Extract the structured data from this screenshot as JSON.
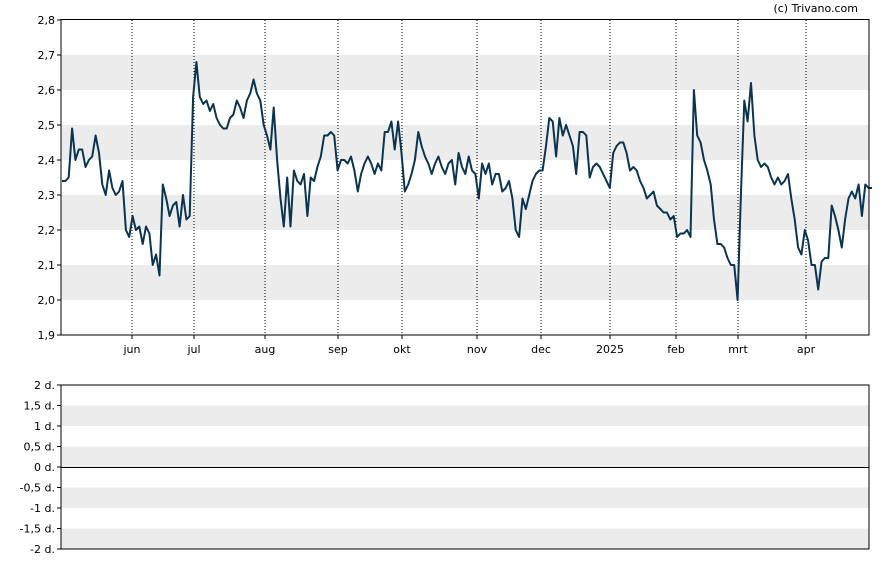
{
  "copyright": "(c) Trivano.com",
  "colors": {
    "line": "#0a3450",
    "band": "#ececec",
    "axis": "#000000"
  },
  "chart_data": [
    {
      "type": "line",
      "x_labels": [
        "jun",
        "jul",
        "aug",
        "sep",
        "okt",
        "nov",
        "dec",
        "2025",
        "feb",
        "mrt",
        "apr"
      ],
      "y_ticks": [
        "1,9",
        "2,0",
        "2,1",
        "2,2",
        "2,3",
        "2,4",
        "2,5",
        "2,6",
        "2,7",
        "2,8"
      ],
      "ylim": [
        1.9,
        2.8
      ],
      "grid": "vertical dotted at month starts, alternating horizontal bands",
      "series": [
        {
          "values": [
            2.34,
            2.34,
            2.35,
            2.49,
            2.4,
            2.43,
            2.43,
            2.38,
            2.4,
            2.41,
            2.47,
            2.42,
            2.33,
            2.3,
            2.37,
            2.32,
            2.3,
            2.31,
            2.34,
            2.2,
            2.18,
            2.24,
            2.2,
            2.21,
            2.16,
            2.21,
            2.19,
            2.1,
            2.13,
            2.07,
            2.33,
            2.29,
            2.24,
            2.27,
            2.28,
            2.21,
            2.3,
            2.23,
            2.24,
            2.58,
            2.68,
            2.58,
            2.56,
            2.57,
            2.54,
            2.56,
            2.52,
            2.5,
            2.49,
            2.49,
            2.52,
            2.53,
            2.57,
            2.55,
            2.52,
            2.57,
            2.59,
            2.63,
            2.59,
            2.57,
            2.5,
            2.47,
            2.43,
            2.55,
            2.4,
            2.29,
            2.21,
            2.35,
            2.21,
            2.37,
            2.34,
            2.33,
            2.36,
            2.24,
            2.35,
            2.34,
            2.38,
            2.41,
            2.47,
            2.47,
            2.48,
            2.47,
            2.37,
            2.4,
            2.4,
            2.39,
            2.41,
            2.37,
            2.31,
            2.36,
            2.39,
            2.41,
            2.39,
            2.36,
            2.39,
            2.37,
            2.48,
            2.48,
            2.51,
            2.43,
            2.51,
            2.42,
            2.31,
            2.33,
            2.36,
            2.4,
            2.48,
            2.44,
            2.41,
            2.39,
            2.36,
            2.39,
            2.41,
            2.38,
            2.36,
            2.39,
            2.4,
            2.33,
            2.42,
            2.38,
            2.36,
            2.41,
            2.37,
            2.36,
            2.29,
            2.39,
            2.36,
            2.39,
            2.33,
            2.36,
            2.36,
            2.31,
            2.32,
            2.34,
            2.29,
            2.2,
            2.18,
            2.29,
            2.26,
            2.3,
            2.34,
            2.36,
            2.37,
            2.37,
            2.44,
            2.52,
            2.51,
            2.41,
            2.52,
            2.47,
            2.5,
            2.47,
            2.44,
            2.36,
            2.48,
            2.48,
            2.47,
            2.35,
            2.38,
            2.39,
            2.38,
            2.36,
            2.34,
            2.32,
            2.42,
            2.44,
            2.45,
            2.45,
            2.42,
            2.37,
            2.38,
            2.37,
            2.34,
            2.32,
            2.29,
            2.3,
            2.31,
            2.27,
            2.26,
            2.25,
            2.25,
            2.23,
            2.24,
            2.18,
            2.19,
            2.19,
            2.2,
            2.18,
            2.6,
            2.47,
            2.45,
            2.4,
            2.37,
            2.33,
            2.23,
            2.16,
            2.16,
            2.15,
            2.12,
            2.1,
            2.1,
            2.0,
            2.3,
            2.57,
            2.51,
            2.62,
            2.47,
            2.4,
            2.38,
            2.39,
            2.38,
            2.35,
            2.33,
            2.35,
            2.33,
            2.34,
            2.36,
            2.29,
            2.23,
            2.15,
            2.13,
            2.2,
            2.17,
            2.1,
            2.1,
            2.03,
            2.11,
            2.12,
            2.12,
            2.27,
            2.24,
            2.2,
            2.15,
            2.23,
            2.29,
            2.31,
            2.29,
            2.33,
            2.24,
            2.33,
            2.32,
            2.32
          ]
        }
      ]
    },
    {
      "type": "line",
      "y_ticks": [
        "2 d.",
        "1,5 d.",
        "1 d.",
        "0,5 d.",
        "0 d.",
        "-0,5 d.",
        "-1 d.",
        "-1,5 d.",
        "-2 d."
      ],
      "ylim": [
        -2,
        2
      ],
      "zero_line": "0 d.",
      "series": []
    }
  ]
}
